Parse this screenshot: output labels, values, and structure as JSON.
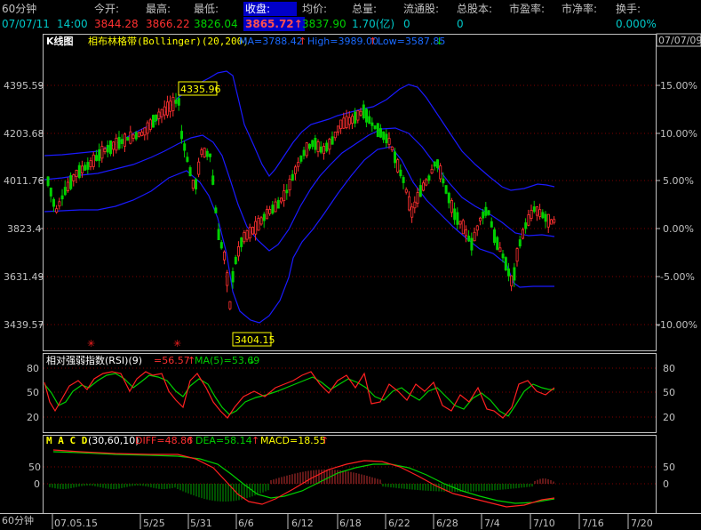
{
  "header": {
    "labels": [
      "60分钟",
      "今开:",
      "最高:",
      "最低:",
      "收盘:",
      "均价:",
      "总量:",
      "流通股:",
      "总股本:",
      "市盈率:",
      "市净率:",
      "换手:"
    ],
    "date": "07/07/11",
    "time": "14:00",
    "open": "3844.28",
    "high": "3866.22",
    "low": "3826.04",
    "close": "3865.72",
    "close_arrow": "↑",
    "avg": "3837.90",
    "volume": "1.70(亿)",
    "float_shares": "0",
    "total_shares": "0",
    "pe": "",
    "pb": "",
    "turnover": "0.000%"
  },
  "kline_panel": {
    "title": "K线图",
    "indicator": "相布林格带(Bollinger)(20,200)",
    "ma_label": "MA=3788.42",
    "high_label": "High=3989.00",
    "low_label": "Low=3587.85",
    "date_box": "07/07/09",
    "y_ticks": [
      "4395.59",
      "4203.68",
      "4011.76",
      "3823.4",
      "3631.49",
      "3439.57"
    ],
    "pct_ticks": [
      "15.00%",
      "10.00%",
      "5.00%",
      "0.00%",
      "-5.00%",
      "-10.00%"
    ],
    "peak_label": "4335.96",
    "trough_label": "3404.15"
  },
  "rsi_panel": {
    "title": "相对强弱指数(RSI)(9)",
    "value_label": "=56.57",
    "ma_label": "MA(5)=53.69",
    "y_ticks": [
      "80",
      "50",
      "20"
    ]
  },
  "macd_panel": {
    "title": "M A C D",
    "params": "(30,60,10)",
    "diff_label": "DIFF=48.86",
    "dea_label": "DEA=58.14",
    "macd_label": "MACD=18.55",
    "y_ticks": [
      "50",
      "0"
    ]
  },
  "x_axis": {
    "period_label": "60分钟",
    "ticks": [
      "07.05.15",
      "5/25",
      "5/31",
      "6/6",
      "6/12",
      "6/18",
      "6/22",
      "6/28",
      "7/4",
      "7/10",
      "7/16",
      "7/20"
    ]
  },
  "chart_data": {
    "type": "candlestick",
    "ma_value": 3788.42,
    "high_value": 3989.0,
    "low_value": 3587.85,
    "peak": 4335.96,
    "trough": 3404.15,
    "rsi": 56.57,
    "rsi_ma5": 53.69,
    "macd_diff": 48.86,
    "macd_dea": 58.14,
    "macd": 18.55
  },
  "colors": {
    "up": "#ff3030",
    "down": "#00d000",
    "band": "#1a1aff",
    "grid": "#800000",
    "axis": "#c0c0c0",
    "highlight": "#0000c8",
    "label_box": "#ffff00"
  }
}
